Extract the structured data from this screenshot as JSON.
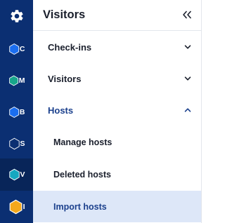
{
  "rail": {
    "settings_icon": "gear-icon",
    "apps": [
      {
        "letter": "C",
        "color": "#1b6ef0"
      },
      {
        "letter": "M",
        "color": "#17a58b"
      },
      {
        "letter": "B",
        "color": "#1b6ef0"
      },
      {
        "letter": "S",
        "color": "#0b2f72"
      },
      {
        "letter": "V",
        "color": "#16a7c0"
      },
      {
        "letter": "I",
        "color": "#f4a81c"
      }
    ]
  },
  "panel": {
    "title": "Visitors",
    "collapse_icon": "double-chevron-left-icon",
    "sections": [
      {
        "label": "Check-ins",
        "expanded": false
      },
      {
        "label": "Visitors",
        "expanded": false
      },
      {
        "label": "Hosts",
        "expanded": true
      }
    ],
    "host_items": [
      {
        "label": "Manage hosts"
      },
      {
        "label": "Deleted hosts"
      },
      {
        "label": "Import hosts"
      }
    ]
  },
  "colors": {
    "rail_bg": "#0b2f72",
    "active_text": "#1a3f8c",
    "selected_bg": "#dde7f8"
  }
}
